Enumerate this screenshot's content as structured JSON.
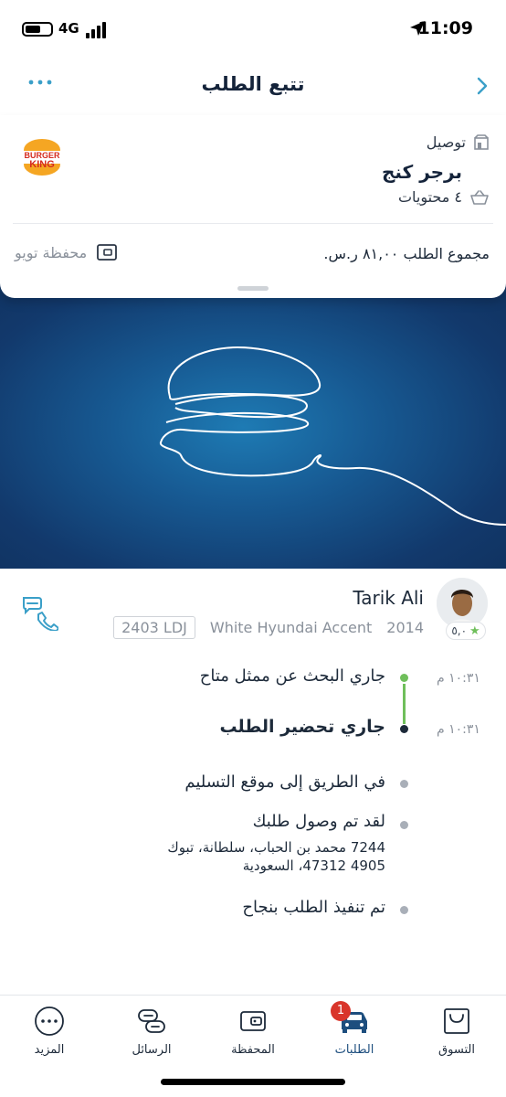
{
  "status_bar": {
    "time": "11:09",
    "network": "4G"
  },
  "header": {
    "title": "تتبع الطلب"
  },
  "order": {
    "type": "توصيل",
    "restaurant": "برجر كنج",
    "logo_top": "BURGER",
    "logo_bottom": "KING",
    "items": "٤ محتويات",
    "total": "مجموع الطلب ٨١,٠٠ ر.س.",
    "wallet_label": "محفظة تويو"
  },
  "driver": {
    "name": "Tarik Ali",
    "rating": "٥,٠",
    "car_year": "2014",
    "car_model": "White Hyundai Accent",
    "plate": "2403 LDJ"
  },
  "timeline": [
    {
      "time": "١٠:٣١ م",
      "label": "جاري البحث عن ممثل متاح",
      "state": "done"
    },
    {
      "time": "١٠:٣١ م",
      "label": "جاري تحضير الطلب",
      "state": "current"
    },
    {
      "time": "",
      "label": "في الطريق إلى موقع التسليم",
      "state": "pending"
    },
    {
      "time": "",
      "label": "لقد تم وصول طلبك",
      "state": "pending",
      "address_line1": "7244 محمد بن الحباب، سلطانة، تبوك",
      "address_line2": "4905 47312، السعودية"
    },
    {
      "time": "",
      "label": "تم تنفيذ الطلب بنجاح",
      "state": "pending"
    }
  ],
  "tabs": [
    {
      "label": "المزيد",
      "icon": "more-icon"
    },
    {
      "label": "الرسائل",
      "icon": "messages-icon"
    },
    {
      "label": "المحفظة",
      "icon": "wallet-icon"
    },
    {
      "label": "الطلبات",
      "icon": "car-icon",
      "badge": "1",
      "active": true
    },
    {
      "label": "التسوق",
      "icon": "shopping-bag-icon"
    }
  ],
  "colors": {
    "primary": "#1d4e7e",
    "accent": "#3aa0c8",
    "success": "#6fbf5b",
    "badge": "#d9352b",
    "hero": "#12396c"
  }
}
